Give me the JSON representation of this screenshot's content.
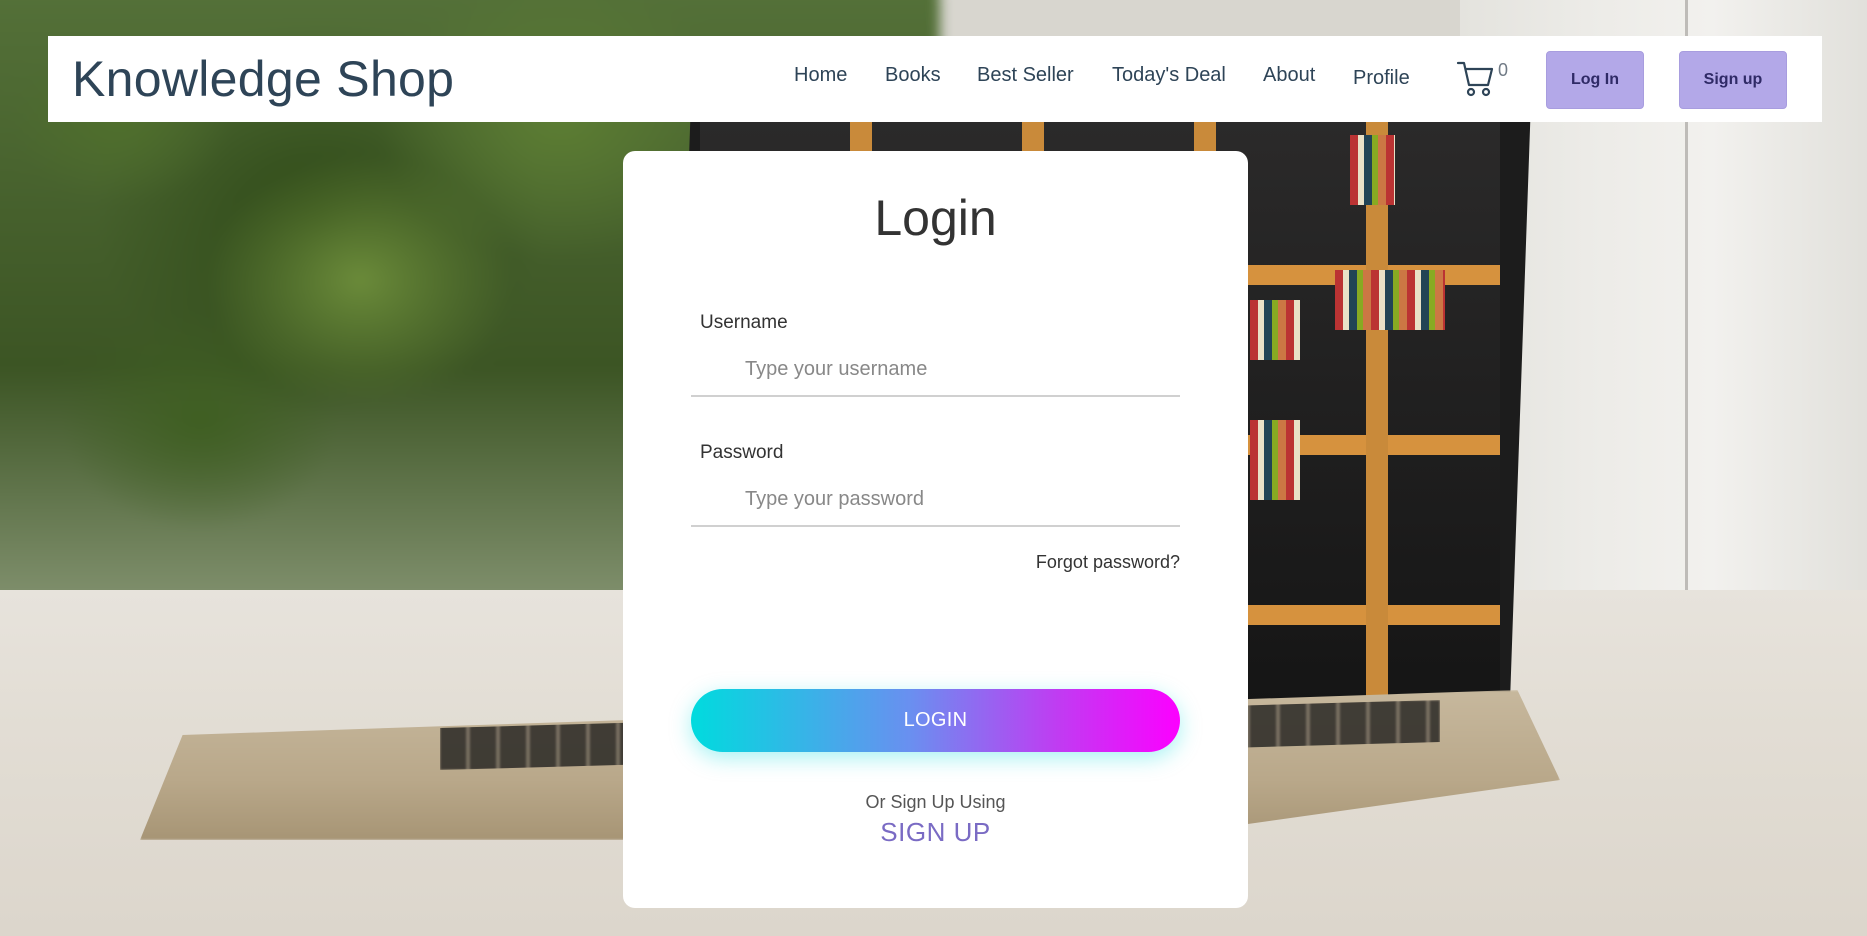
{
  "navbar": {
    "brand": "Knowledge Shop",
    "links": [
      "Home",
      "Books",
      "Best Seller",
      "Today's Deal",
      "About",
      "Profile"
    ],
    "cart_icon": "shopping-cart-icon",
    "cart_count": "0",
    "login_label": "Log In",
    "signup_label": "Sign up",
    "button_color": "#b3a8e8"
  },
  "login": {
    "title": "Login",
    "username_label": "Username",
    "username_placeholder": "Type your username",
    "password_label": "Password",
    "password_placeholder": "Type your password",
    "forgot_label": "Forgot password?",
    "submit_label": "LOGIN",
    "alt_text": "Or Sign Up Using",
    "signup_label": "SIGN UP",
    "gradient": [
      "#00dbde",
      "#fc00ff"
    ],
    "signup_color": "#7a6bc4"
  }
}
